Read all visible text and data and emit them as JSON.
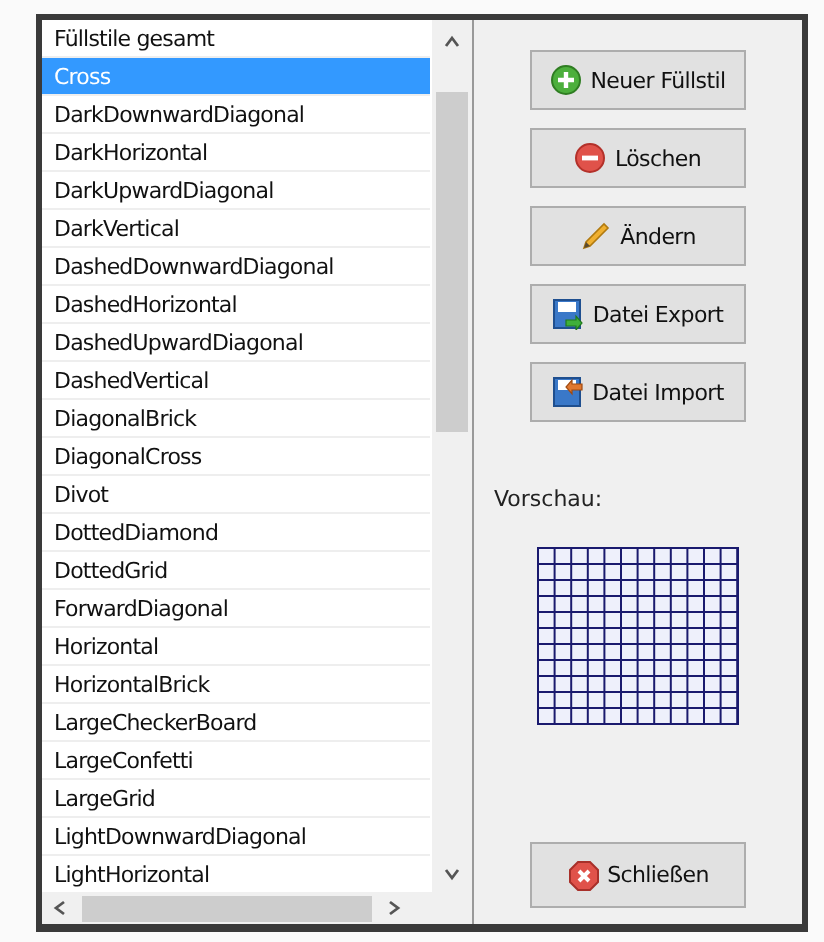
{
  "list": {
    "items": [
      {
        "label": "Füllstile gesamt",
        "selected": false
      },
      {
        "label": "Cross",
        "selected": true
      },
      {
        "label": "DarkDownwardDiagonal",
        "selected": false
      },
      {
        "label": "DarkHorizontal",
        "selected": false
      },
      {
        "label": "DarkUpwardDiagonal",
        "selected": false
      },
      {
        "label": "DarkVertical",
        "selected": false
      },
      {
        "label": "DashedDownwardDiagonal",
        "selected": false
      },
      {
        "label": "DashedHorizontal",
        "selected": false
      },
      {
        "label": "DashedUpwardDiagonal",
        "selected": false
      },
      {
        "label": "DashedVertical",
        "selected": false
      },
      {
        "label": "DiagonalBrick",
        "selected": false
      },
      {
        "label": "DiagonalCross",
        "selected": false
      },
      {
        "label": "Divot",
        "selected": false
      },
      {
        "label": "DottedDiamond",
        "selected": false
      },
      {
        "label": "DottedGrid",
        "selected": false
      },
      {
        "label": "ForwardDiagonal",
        "selected": false
      },
      {
        "label": "Horizontal",
        "selected": false
      },
      {
        "label": "HorizontalBrick",
        "selected": false
      },
      {
        "label": "LargeCheckerBoard",
        "selected": false
      },
      {
        "label": "LargeConfetti",
        "selected": false
      },
      {
        "label": "LargeGrid",
        "selected": false
      },
      {
        "label": "LightDownwardDiagonal",
        "selected": false
      },
      {
        "label": "LightHorizontal",
        "selected": false
      }
    ]
  },
  "buttons": [
    {
      "label": "Neuer Füllstil",
      "kind": "add"
    },
    {
      "label": "Löschen",
      "kind": "delete"
    },
    {
      "label": "Ändern",
      "kind": "edit"
    },
    {
      "label": "Datei Export",
      "kind": "export"
    },
    {
      "label": "Datei Import",
      "kind": "import"
    }
  ],
  "preview": {
    "label": "Vorschau:"
  },
  "close_button": {
    "label": "Schließen",
    "kind": "close"
  }
}
